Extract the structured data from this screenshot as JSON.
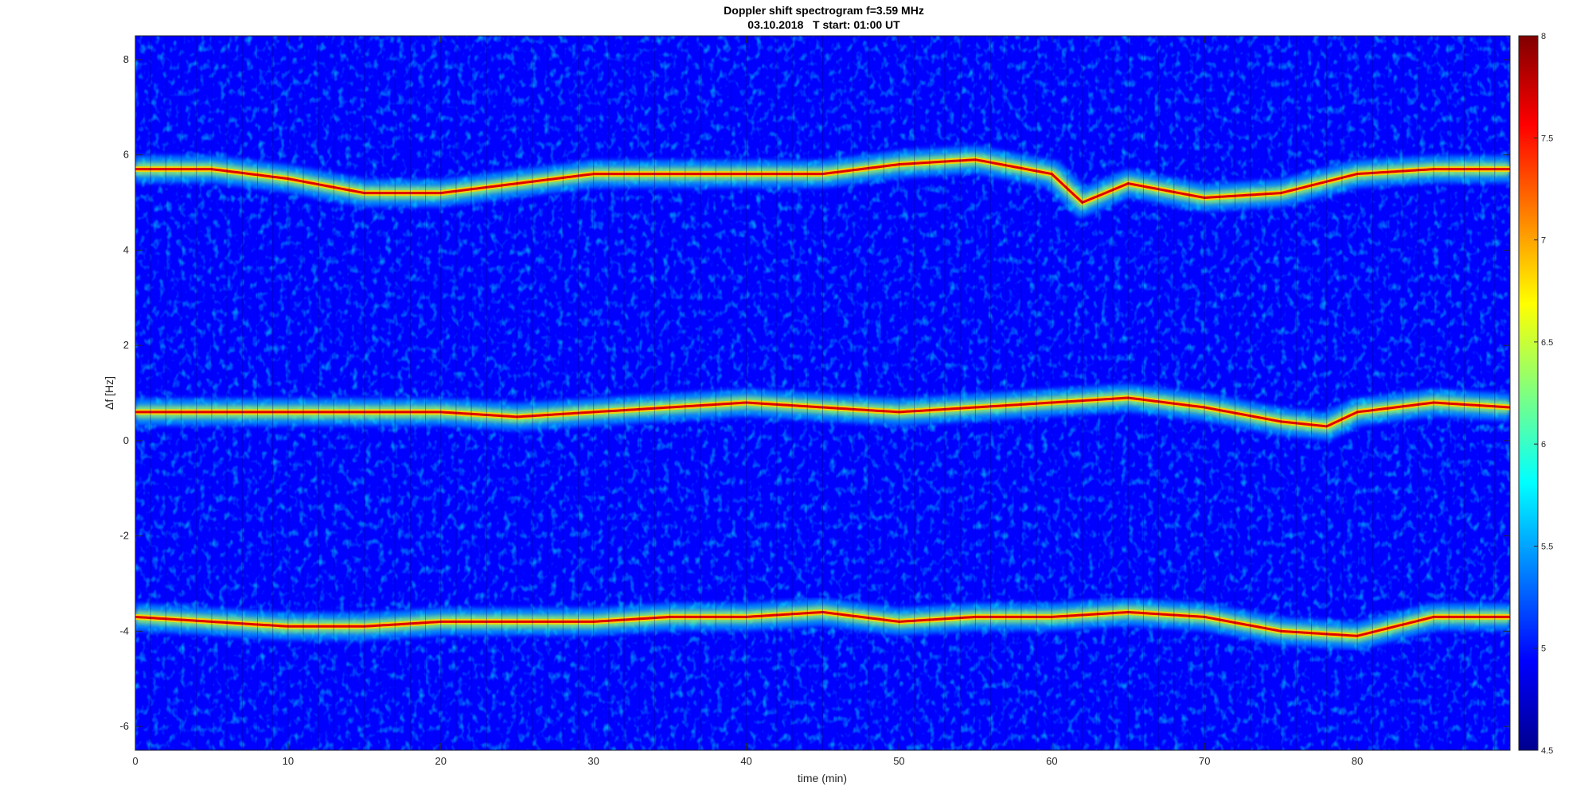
{
  "chart_data": {
    "type": "heatmap",
    "title": "Doppler shift spectrogram f=3.59 MHz",
    "subtitle": "03.10.2018   T start: 01:00 UT",
    "xlabel": "time (min)",
    "ylabel": "Δf [Hz]",
    "xlim": [
      0,
      90
    ],
    "ylim": [
      -6.5,
      8.5
    ],
    "xticks": [
      0,
      10,
      20,
      30,
      40,
      50,
      60,
      70,
      80
    ],
    "yticks": [
      -6,
      -4,
      -2,
      0,
      2,
      4,
      6,
      8
    ],
    "colormap": "jet",
    "clim": [
      4.5,
      8
    ],
    "colorbar_ticks": [
      4.5,
      5,
      5.5,
      6,
      6.5,
      7,
      7.5,
      8
    ],
    "background_level": 5.0,
    "grid": false,
    "series": [
      {
        "t": [
          0,
          5,
          10,
          15,
          20,
          25,
          30,
          35,
          40,
          45,
          50,
          55,
          60,
          62,
          65,
          70,
          75,
          80,
          85,
          90
        ],
        "df": [
          5.7,
          5.7,
          5.5,
          5.2,
          5.2,
          5.4,
          5.6,
          5.6,
          5.6,
          5.6,
          5.8,
          5.9,
          5.6,
          5.0,
          5.4,
          5.1,
          5.2,
          5.6,
          5.7,
          5.7
        ]
      },
      {
        "t": [
          0,
          5,
          10,
          15,
          20,
          25,
          30,
          35,
          40,
          45,
          50,
          55,
          60,
          65,
          70,
          75,
          78,
          80,
          85,
          90
        ],
        "df": [
          0.6,
          0.6,
          0.6,
          0.6,
          0.6,
          0.5,
          0.6,
          0.7,
          0.8,
          0.7,
          0.6,
          0.7,
          0.8,
          0.9,
          0.7,
          0.4,
          0.3,
          0.6,
          0.8,
          0.7
        ]
      },
      {
        "t": [
          0,
          5,
          10,
          15,
          20,
          25,
          30,
          35,
          40,
          45,
          50,
          55,
          60,
          65,
          70,
          75,
          80,
          85,
          90
        ],
        "df": [
          -3.7,
          -3.8,
          -3.9,
          -3.9,
          -3.8,
          -3.8,
          -3.8,
          -3.7,
          -3.7,
          -3.6,
          -3.8,
          -3.7,
          -3.7,
          -3.6,
          -3.7,
          -4.0,
          -4.1,
          -3.7,
          -3.7
        ]
      }
    ]
  }
}
